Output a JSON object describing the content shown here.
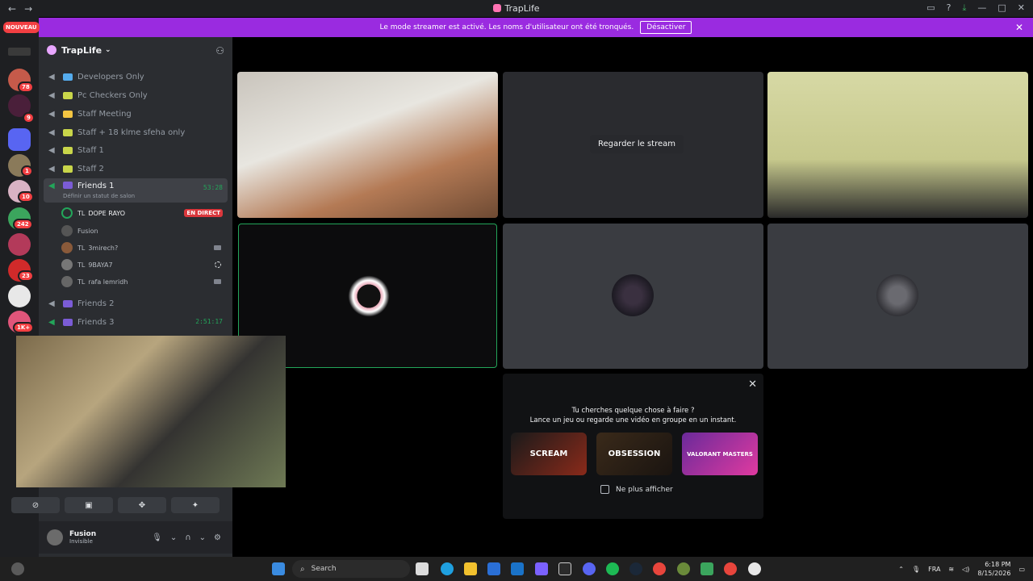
{
  "window": {
    "title": "TrapLife",
    "nav_back": "←",
    "nav_forward": "→"
  },
  "notice": {
    "text": "Le mode streamer est activé. Les noms d'utilisateur ont été tronqués.",
    "button": "Désactiver"
  },
  "rail": {
    "new_badge": "NOUVEAU",
    "badges": [
      "78",
      "9",
      "1",
      "10",
      "242",
      "23",
      "1K+"
    ]
  },
  "guild": {
    "name": "TrapLife"
  },
  "channels": [
    {
      "name": "Developers Only",
      "emoji_color": "#55acee"
    },
    {
      "name": "Pc Checkers Only",
      "emoji_color": "#c9d64a"
    },
    {
      "name": "Staff Meeting",
      "emoji_color": "#f4c542"
    },
    {
      "name": "Staff + 18 klme sfeha only",
      "emoji_color": "#c9d64a"
    },
    {
      "name": "Staff 1",
      "emoji_color": "#c9d64a"
    },
    {
      "name": "Staff 2",
      "emoji_color": "#c9d64a"
    }
  ],
  "active_channel": {
    "name": "Friends 1",
    "time": "53:28",
    "status_hint": "Définir un statut de salon"
  },
  "voice_users": [
    {
      "prefix": "TL",
      "name": "DOPE RAYO",
      "badge": "EN DIRECT"
    },
    {
      "prefix": "",
      "name": "Fusion",
      "badge": ""
    },
    {
      "prefix": "TL",
      "name": "3mirech?",
      "badge": ""
    },
    {
      "prefix": "TL",
      "name": "9BAYA7",
      "badge": ""
    },
    {
      "prefix": "TL",
      "name": "rafa lemridh",
      "badge": ""
    }
  ],
  "more_channels": [
    {
      "name": "Friends 2",
      "time": ""
    },
    {
      "name": "Friends 3",
      "time": "2:51:17"
    }
  ],
  "user_panel": {
    "name": "Fusion",
    "status": "Invisible"
  },
  "stream": {
    "watch_label": "Regarder le stream"
  },
  "activity": {
    "line1": "Tu cherches quelque chose à faire ?",
    "line2": "Lance un jeu ou regarde une vidéo en groupe en un instant.",
    "games": [
      "SCREAM",
      "OBSESSION",
      "VALORANT MASTERS"
    ],
    "checkbox_label": "Ne plus afficher"
  },
  "taskbar": {
    "search_placeholder": "Search",
    "language": "FRA",
    "time": "6:18 PM",
    "date": "8/15/2026"
  }
}
